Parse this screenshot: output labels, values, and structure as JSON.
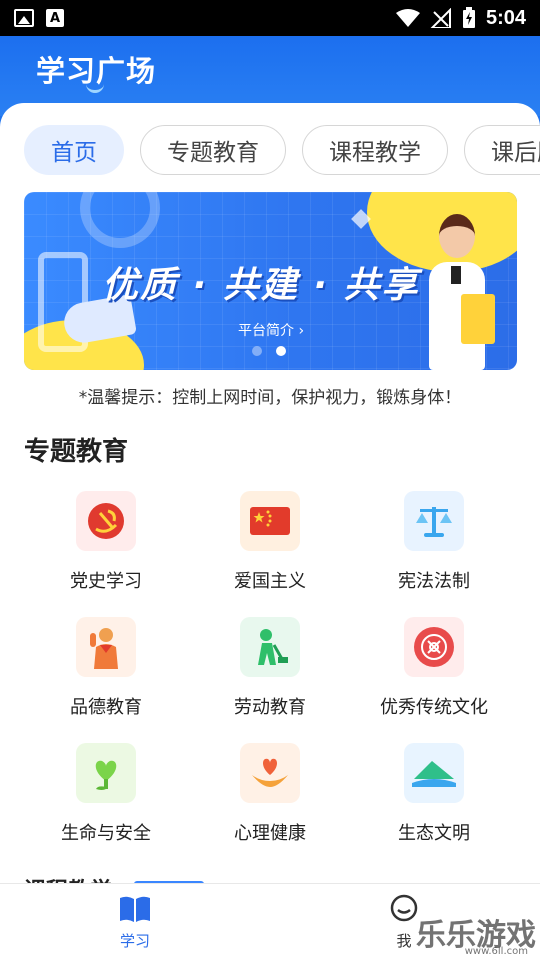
{
  "status_bar": {
    "time": "5:04"
  },
  "header": {
    "title": "学习广场"
  },
  "tabs": [
    {
      "label": "首页",
      "active": true
    },
    {
      "label": "专题教育",
      "active": false
    },
    {
      "label": "课程教学",
      "active": false
    },
    {
      "label": "课后服务",
      "active": false
    }
  ],
  "banner": {
    "slogan": "优质 · 共建 · 共享",
    "link_label": "平台简介",
    "slide_count": 2,
    "active_slide": 2
  },
  "tip": "*温馨提示：控制上网时间，保护视力，锻炼身体！",
  "section_title": "专题教育",
  "topics": [
    {
      "label": "党史学习",
      "icon": "party-emblem-icon",
      "bg": "#ffecec",
      "fg": "#e03a2f"
    },
    {
      "label": "爱国主义",
      "icon": "national-flag-icon",
      "bg": "#fff0e0",
      "fg": "#e23b2b"
    },
    {
      "label": "宪法法制",
      "icon": "scales-icon",
      "bg": "#e8f3ff",
      "fg": "#3aa6ee"
    },
    {
      "label": "品德教育",
      "icon": "young-pioneer-icon",
      "bg": "#fff1e8",
      "fg": "#f07a3a"
    },
    {
      "label": "劳动教育",
      "icon": "labor-worker-icon",
      "bg": "#e8f8ee",
      "fg": "#2fbf6a"
    },
    {
      "label": "优秀传统文化",
      "icon": "chinese-knot-icon",
      "bg": "#ffecec",
      "fg": "#e84b4b"
    },
    {
      "label": "生命与安全",
      "icon": "heart-sprout-icon",
      "bg": "#ecf9e3",
      "fg": "#7bd44a"
    },
    {
      "label": "心理健康",
      "icon": "hands-heart-icon",
      "bg": "#fff1e6",
      "fg": "#f0623a"
    },
    {
      "label": "生态文明",
      "icon": "mountain-landscape-icon",
      "bg": "#e8f4ff",
      "fg": "#2fbf8a"
    }
  ],
  "next_section_title": "课程教学",
  "bottom_nav": [
    {
      "label": "学习",
      "active": true
    },
    {
      "label": "我",
      "active": false
    }
  ],
  "watermark": {
    "text": "乐乐游戏",
    "url": "www.6ll.com"
  }
}
